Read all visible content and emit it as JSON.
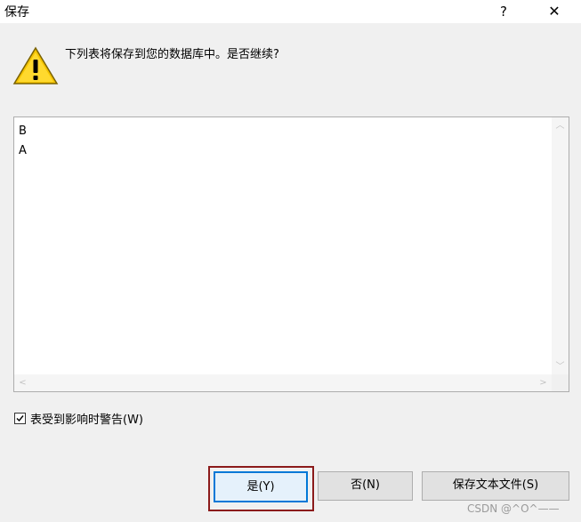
{
  "window": {
    "title": "保存",
    "help_label": "?",
    "close_label": "✕"
  },
  "message": "下列表将保存到您的数据库中。是否继续?",
  "icon": "warning-icon",
  "list": {
    "items": [
      "B",
      "A"
    ]
  },
  "checkbox": {
    "label": "表受到影响时警告(W)",
    "checked": true
  },
  "buttons": {
    "yes": "是(Y)",
    "no": "否(N)",
    "save_text": "保存文本文件(S)"
  },
  "watermark": "CSDN @^O^——",
  "colors": {
    "highlight_outline": "#8b1a1a",
    "default_button_border": "#0078d7",
    "warning_yellow": "#f5c400"
  }
}
